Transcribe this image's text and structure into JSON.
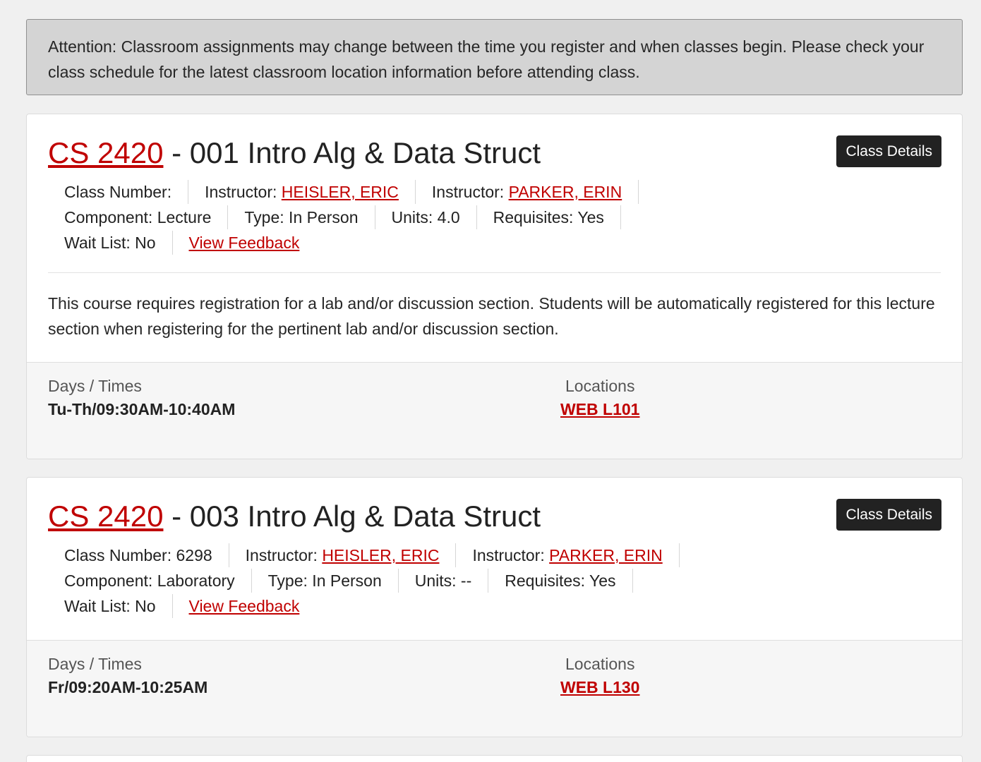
{
  "notice": {
    "text": "Attention: Classroom assignments may change between the time you register and when classes begin. Please check your class schedule for the latest classroom location information before attending class."
  },
  "sections": [
    {
      "course_link": "CS 2420",
      "title_rest": " - 001 Intro Alg & Data Struct",
      "details_button": "Class Details",
      "class_number": "Class Number:",
      "instructor_label": "Instructor:",
      "instructors": [
        "HEISLER, ERIC",
        "PARKER, ERIN"
      ],
      "component": "Component: Lecture",
      "type": "Type: In Person",
      "units": "Units: 4.0",
      "requisites": "Requisites: Yes",
      "wait_list": "Wait List: No",
      "feedback_link": "View Feedback",
      "description": "This course requires registration for a lab and/or discussion section. Students will be automatically registered for this lecture section when registering for the pertinent lab and/or discussion section.",
      "days_label": "Days / Times",
      "days_value": "Tu-Th/09:30AM-10:40AM",
      "locations_label": "Locations",
      "location_link": "WEB L101"
    },
    {
      "course_link": "CS 2420",
      "title_rest": " - 003 Intro Alg & Data Struct",
      "details_button": "Class Details",
      "class_number": "Class Number: 6298",
      "instructor_label": "Instructor:",
      "instructors": [
        "HEISLER, ERIC",
        "PARKER, ERIN"
      ],
      "component": "Component: Laboratory",
      "type": "Type: In Person",
      "units": "Units: --",
      "requisites": "Requisites: Yes",
      "wait_list": "Wait List: No",
      "feedback_link": "View Feedback",
      "days_label": "Days / Times",
      "days_value": "Fr/09:20AM-10:25AM",
      "locations_label": "Locations",
      "location_link": "WEB L130"
    }
  ],
  "colors": {
    "link": "#c00000",
    "button_bg": "#222222",
    "notice_bg": "#d4d4d4",
    "page_bg": "#f0f0f0"
  }
}
